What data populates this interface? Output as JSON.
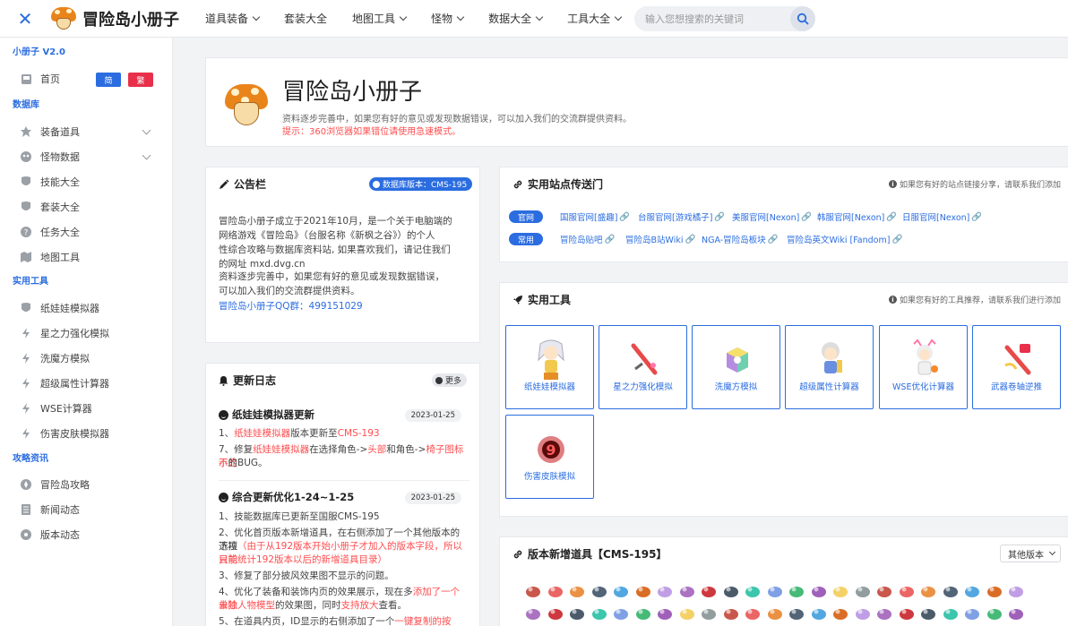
{
  "header": {
    "site_name": "冒险岛小册子",
    "nav": [
      "道具装备",
      "套装大全",
      "地图工具",
      "怪物",
      "数据大全",
      "工具大全"
    ],
    "search_placeholder": "输入您想搜索的关键词"
  },
  "sidebar": {
    "version_label": "小册子 V2.0",
    "home": "首页",
    "lang_simplified": "简",
    "lang_traditional": "繁",
    "sections": {
      "database": "数据库",
      "tools": "实用工具",
      "guides": "攻略资讯"
    },
    "database_items": [
      "装备道具",
      "怪物数据",
      "技能大全",
      "套装大全",
      "任务大全",
      "地图工具"
    ],
    "tool_items": [
      "纸娃娃模拟器",
      "星之力强化模拟",
      "洗魔方模拟",
      "超级属性计算器",
      "WSE计算器",
      "伤害皮肤模拟器"
    ],
    "guide_items": [
      "冒险岛攻略",
      "新闻动态",
      "版本动态"
    ]
  },
  "hero": {
    "title": "冒险岛小册子",
    "description": "资料逐步完善中，如果您有好的意见或发现数据错误，可以加入我们的交流群提供资料。",
    "tip": "提示：360浏览器如果错位请使用急速模式。"
  },
  "notice": {
    "title": "公告栏",
    "db_version": "数据库版本：CMS-195",
    "lines": [
      "冒险岛小册子成立于2021年10月，是一个关于电脑端的",
      "网络游戏《冒险岛》（台服名称《新枫之谷》）的个人",
      "性综合攻略与数据库资料站, 如果喜欢我们，请记住我们",
      "的网址 mxd.dvg.cn"
    ],
    "lines2": [
      "资料逐步完善中，如果您有好的意见或发现数据错误，",
      "可以加入我们的交流群提供资料。"
    ],
    "qq": "冒险岛小册子QQ群：499151029"
  },
  "changelog": {
    "title": "更新日志",
    "more": "更多",
    "entry1": {
      "title": "纸娃娃模拟器更新",
      "date": "2023-01-25",
      "l1_a": "1、",
      "l1_b": "纸娃娃模拟器",
      "l1_c": "版本更新至",
      "l1_d": "CMS-193",
      "l2_a": "7、修复",
      "l2_b": "纸娃娃模拟器",
      "l2_c": "在选择角色->",
      "l2_d": "头部",
      "l2_e": "和角色->",
      "l2_f": "椅子图标不显",
      "l3_a": "示",
      "l3_b": "的BUG。"
    },
    "entry2": {
      "title": "综合更新优化1-24~1-25",
      "date": "2023-01-25",
      "l1": "1、技能数据库已更新至国服CMS-195",
      "l2": "2、优化首页版本新增道具，在右侧添加了一个其他版本的下拉",
      "l3_a": "选项",
      "l3_b": "（由于从192版本开始小册子才加入的版本字段，所以目前",
      "l4": "只能统计192版本以后的新增道具目录）",
      "l5": "3、修复了部分披风效果图不显示的问题。",
      "l6_a": "4、优化了装备和装饰内页的效果展示，现在多",
      "l6_b": "添加了一个单独",
      "l7_a": "去除人物模型",
      "l7_b": "的效果图，同时",
      "l7_c": "支持放大",
      "l7_d": "查看。",
      "l8_a": "5、在道具内页，ID显示的右侧添加了一个",
      "l8_b": "一键复制的按钮",
      "l8_c": "，方"
    }
  },
  "portal": {
    "title": "实用站点传送门",
    "hint": "如果您有好的站点链接分享，请联系我们添加",
    "row1_tag": "官网",
    "row1_links": [
      "国服官网[盛趣]",
      "台服官网[游戏橘子]",
      "美服官网[Nexon]",
      "韩服官网[Nexon]",
      "日服官网[Nexon]"
    ],
    "row2_tag": "常用",
    "row2_links": [
      "冒险岛贴吧",
      "冒险岛B站Wiki",
      "NGA-冒险岛板块",
      "冒险岛英文Wiki [Fandom]"
    ]
  },
  "tools": {
    "title": "实用工具",
    "hint": "如果您有好的工具推荐，请联系我们进行添加",
    "items": [
      "纸娃娃模拟器",
      "星之力强化模拟",
      "洗魔方模拟",
      "超级属性计算器",
      "WSE优化计算器",
      "武器卷轴逆推",
      "伤害皮肤模拟"
    ]
  },
  "new_items": {
    "title": "版本新增道具【CMS-195】",
    "select": "其他版本"
  },
  "colors": {
    "accent": "#2b6de0",
    "danger": "#ff4d4f",
    "traditional": "#e8304a"
  }
}
